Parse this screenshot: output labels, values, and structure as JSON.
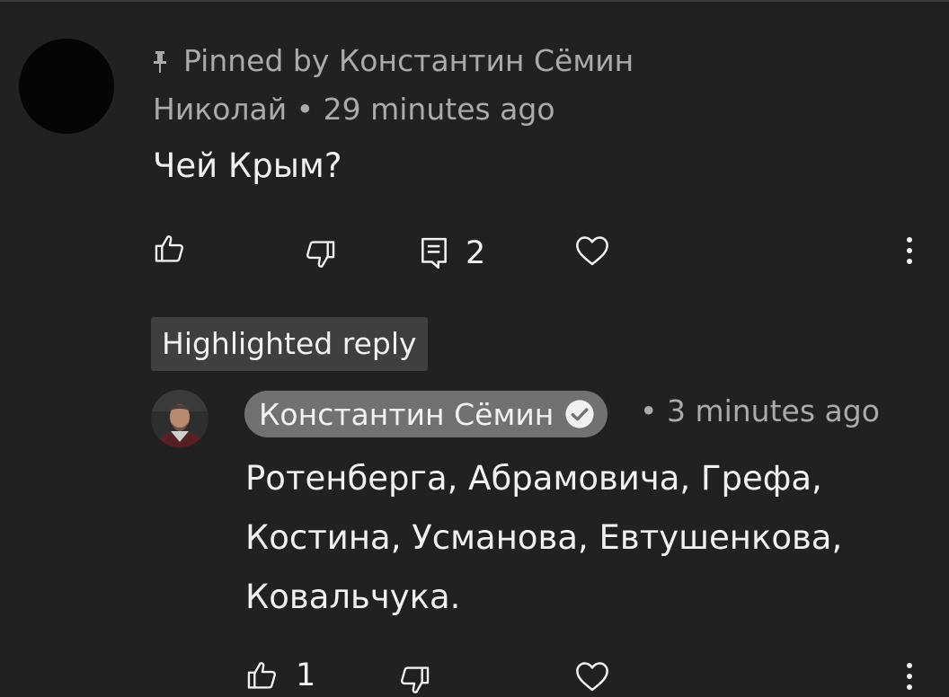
{
  "comment": {
    "pinned_label": "Pinned by Константин Сёмин",
    "author": "Николай",
    "time": "29 minutes ago",
    "text": "Чей Крым?",
    "reply_count": "2",
    "icons": [
      "thumb-up-icon",
      "thumb-down-icon",
      "reply-icon",
      "heart-icon",
      "more-vert-icon"
    ]
  },
  "highlighted": {
    "badge": "Highlighted reply"
  },
  "reply": {
    "author": "Константин Сёмин",
    "verified_icon": "check-circle-icon",
    "time": "3 minutes ago",
    "text_lines": [
      "Ротенберга, Абрамовича, Грефа,",
      "Костина, Усманова, Евтушенкова,",
      "Ковальчука."
    ],
    "like_count": "1"
  },
  "colors": {
    "background": "#212121",
    "secondary_text": "#aaaaaa",
    "primary_text": "#f1f1f1",
    "badge_bg": "#3f3f3f",
    "author_chip_bg": "#717171"
  }
}
